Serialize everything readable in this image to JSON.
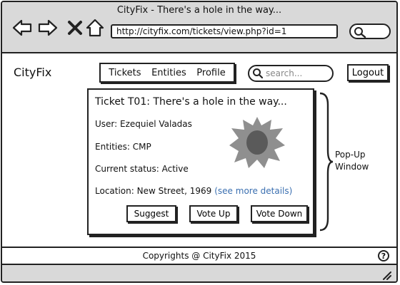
{
  "window": {
    "title": "CityFix - There's a hole in the way...",
    "url": "http://cityfix.com/tickets/view.php?id=1"
  },
  "icons": {
    "back": "arrow-left-icon",
    "forward": "arrow-right-icon",
    "stop": "close-icon",
    "home": "home-icon",
    "search": "search-icon",
    "help": "question-icon",
    "hole": "hole-image",
    "resize": "resize-grip-icon"
  },
  "header": {
    "brand": "CityFix",
    "nav": [
      "Tickets",
      "Entities",
      "Profile"
    ],
    "search_placeholder": "search...",
    "logout": "Logout"
  },
  "ticket": {
    "title": "Ticket T01: There's a hole in the way...",
    "user": "User: Ezequiel Valadas",
    "entities": "Entities: CMP",
    "status": "Current status: Active",
    "location": "Location: New Street, 1969",
    "details_link": "(see more details)",
    "buttons": {
      "suggest": "Suggest",
      "vote_up": "Vote Up",
      "vote_down": "Vote Down"
    }
  },
  "annotation": {
    "line1": "Pop-Up",
    "line2": "Window"
  },
  "footer": {
    "copyright": "Copyrights @ CityFix 2015",
    "help": "?"
  },
  "colors": {
    "chrome": "#d9d9d9",
    "link": "#3a6fb0",
    "hole_outer": "#8f8f8f",
    "hole_inner": "#5a5a5a"
  }
}
